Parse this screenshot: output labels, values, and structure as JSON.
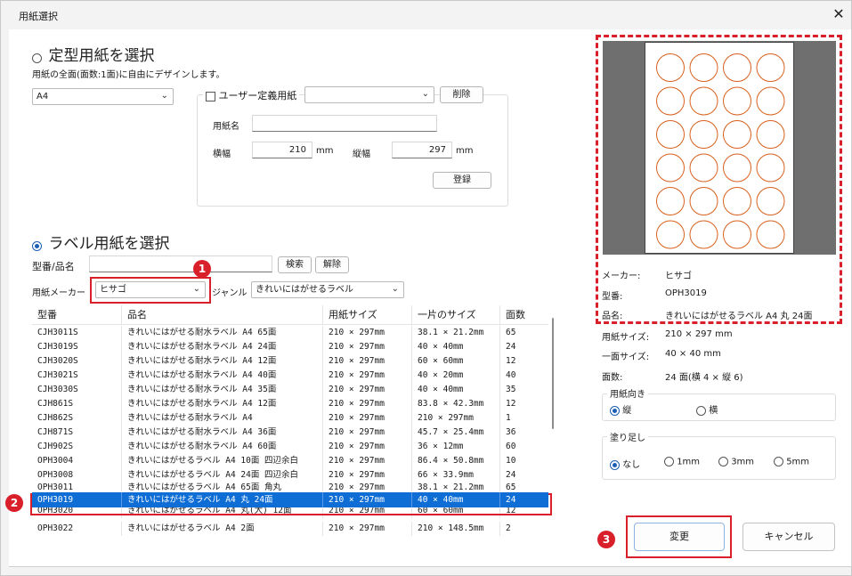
{
  "window": {
    "title": "用紙選択",
    "close_glyph": "✕"
  },
  "standard": {
    "heading": "定型用紙を選択",
    "description": "用紙の全面(面数:1面)に自由にデザインします。",
    "size_select": "A4",
    "custom_checkbox_label": "ユーザー定義用紙",
    "custom_select": "",
    "delete_button": "削除",
    "name_label": "用紙名",
    "name_value": "",
    "width_label": "横幅",
    "width_value": "210",
    "width_unit": "mm",
    "height_label": "縦幅",
    "height_value": "297",
    "height_unit": "mm",
    "register_button": "登録"
  },
  "label": {
    "heading": "ラベル用紙を選択",
    "search_label": "型番/品名",
    "search_value": "",
    "search_button": "検索",
    "clear_button": "解除",
    "maker_label": "用紙メーカー",
    "maker_value": "ヒサゴ",
    "genre_label": "ジャンル",
    "genre_value": "きれいにはがせるラベル"
  },
  "table": {
    "headers": [
      "型番",
      "品名",
      "用紙サイズ",
      "一片のサイズ",
      "面数"
    ],
    "rows": [
      [
        "CJH3011S",
        "きれいにはがせる耐水ラベル A4 65面",
        "210 × 297mm",
        "38.1 × 21.2mm",
        "65"
      ],
      [
        "CJH3019S",
        "きれいにはがせる耐水ラベル A4 24面",
        "210 × 297mm",
        "40 × 40mm",
        "24"
      ],
      [
        "CJH3020S",
        "きれいにはがせる耐水ラベル A4 12面",
        "210 × 297mm",
        "60 × 60mm",
        "12"
      ],
      [
        "CJH3021S",
        "きれいにはがせる耐水ラベル A4 40面",
        "210 × 297mm",
        "40 × 20mm",
        "40"
      ],
      [
        "CJH3030S",
        "きれいにはがせる耐水ラベル A4 35面",
        "210 × 297mm",
        "40 × 40mm",
        "35"
      ],
      [
        "CJH861S",
        "きれいにはがせる耐水ラベル A4 12面",
        "210 × 297mm",
        "83.8 × 42.3mm",
        "12"
      ],
      [
        "CJH862S",
        "きれいにはがせる耐水ラベル A4",
        "210 × 297mm",
        "210 × 297mm",
        "1"
      ],
      [
        "CJH871S",
        "きれいにはがせる耐水ラベル A4 36面",
        "210 × 297mm",
        "45.7 × 25.4mm",
        "36"
      ],
      [
        "CJH902S",
        "きれいにはがせる耐水ラベル A4 60面",
        "210 × 297mm",
        "36 × 12mm",
        "60"
      ],
      [
        "OPH3004",
        "きれいにはがせるラベル A4 10面 四辺余白",
        "210 × 297mm",
        "86.4 × 50.8mm",
        "10"
      ],
      [
        "OPH3008",
        "きれいにはがせるラベル A4 24面 四辺余白",
        "210 × 297mm",
        "66 × 33.9mm",
        "24"
      ],
      [
        "OPH3011",
        "きれいにはがせるラベル A4 65面 角丸",
        "210 × 297mm",
        "38.1 × 21.2mm",
        "65"
      ],
      [
        "OPH3019",
        "きれいにはがせるラベル A4 丸 24面",
        "210 × 297mm",
        "40 × 40mm",
        "24"
      ],
      [
        "OPH3020",
        "きれいにはがせるラベル A4 丸(大) 12面",
        "210 × 297mm",
        "60 × 60mm",
        "12"
      ],
      [
        "OPH3022",
        "きれいにはがせるラベル A4 2面",
        "210 × 297mm",
        "210 × 148.5mm",
        "2"
      ]
    ],
    "selected_index": 12
  },
  "info": {
    "maker_key": "メーカー:",
    "maker_val": "ヒサゴ",
    "model_key": "型番:",
    "model_val": "OPH3019",
    "name_key": "品名:",
    "name_val": "きれいにはがせるラベル A4 丸 24面",
    "paper_key": "用紙サイズ:",
    "paper_val": "210 × 297 mm",
    "piece_key": "一面サイズ:",
    "piece_val": "40 × 40 mm",
    "count_key": "面数:",
    "count_val": "24 面(横 4 × 縦 6)"
  },
  "orientation": {
    "title": "用紙向き",
    "portrait": "縦",
    "landscape": "横",
    "selected": "縦"
  },
  "bleed": {
    "title": "塗り足し",
    "options": [
      "なし",
      "1mm",
      "3mm",
      "5mm"
    ],
    "selected": "なし"
  },
  "buttons": {
    "ok": "変更",
    "cancel": "キャンセル"
  },
  "callouts": [
    "1",
    "2",
    "3"
  ],
  "preview": {
    "label_grid_cols": 4,
    "label_grid_rows": 6,
    "label_color": "#d8601c",
    "highlight_color": "#d9202a"
  }
}
